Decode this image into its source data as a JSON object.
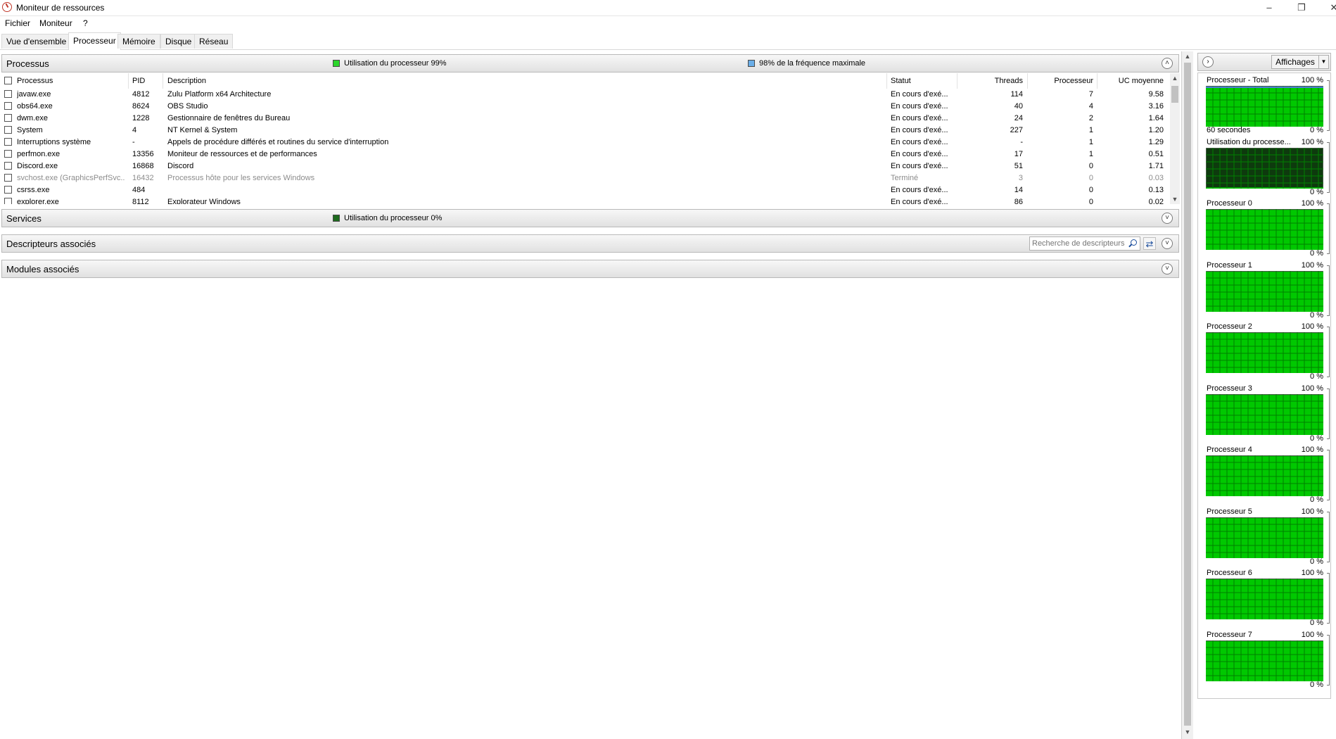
{
  "window": {
    "title": "Moniteur de ressources"
  },
  "menu": [
    "Fichier",
    "Moniteur",
    "?"
  ],
  "tabs": [
    {
      "label": "Vue d'ensemble",
      "active": false
    },
    {
      "label": "Processeur",
      "active": true
    },
    {
      "label": "Mémoire",
      "active": false
    },
    {
      "label": "Disque",
      "active": false
    },
    {
      "label": "Réseau",
      "active": false
    }
  ],
  "colors": {
    "cpu_usage": "#2bd62b",
    "max_freq": "#6aaee8",
    "service_usage": "#1e6b1e",
    "graph_bg": "#0e3a0e",
    "graph_fill": "#00c800",
    "graph_grid": "#008000",
    "freq_line": "#4a7fd4"
  },
  "processes": {
    "title": "Processus",
    "cpu_usage_label": "Utilisation du processeur 99%",
    "max_freq_label": "98% de la fréquence maximale",
    "headers": {
      "name": "Processus",
      "pid": "PID",
      "description": "Description",
      "status": "Statut",
      "threads": "Threads",
      "cpu": "Processeur",
      "avg": "UC moyenne"
    },
    "rows": [
      {
        "name": "javaw.exe",
        "pid": "4812",
        "description": "Zulu Platform x64 Architecture",
        "status": "En cours d'exé...",
        "threads": "114",
        "cpu": "7",
        "avg": "9.58",
        "terminated": false
      },
      {
        "name": "obs64.exe",
        "pid": "8624",
        "description": "OBS Studio",
        "status": "En cours d'exé...",
        "threads": "40",
        "cpu": "4",
        "avg": "3.16",
        "terminated": false
      },
      {
        "name": "dwm.exe",
        "pid": "1228",
        "description": "Gestionnaire de fenêtres du Bureau",
        "status": "En cours d'exé...",
        "threads": "24",
        "cpu": "2",
        "avg": "1.64",
        "terminated": false
      },
      {
        "name": "System",
        "pid": "4",
        "description": "NT Kernel & System",
        "status": "En cours d'exé...",
        "threads": "227",
        "cpu": "1",
        "avg": "1.20",
        "terminated": false
      },
      {
        "name": "Interruptions système",
        "pid": "-",
        "description": "Appels de procédure différés et routines du service d'interruption",
        "status": "En cours d'exé...",
        "threads": "-",
        "cpu": "1",
        "avg": "1.29",
        "terminated": false
      },
      {
        "name": "perfmon.exe",
        "pid": "13356",
        "description": "Moniteur de ressources et de performances",
        "status": "En cours d'exé...",
        "threads": "17",
        "cpu": "1",
        "avg": "0.51",
        "terminated": false
      },
      {
        "name": "Discord.exe",
        "pid": "16868",
        "description": "Discord",
        "status": "En cours d'exé...",
        "threads": "51",
        "cpu": "0",
        "avg": "1.71",
        "terminated": false
      },
      {
        "name": "svchost.exe (GraphicsPerfSvc...",
        "pid": "16432",
        "description": "Processus hôte pour les services Windows",
        "status": "Terminé",
        "threads": "3",
        "cpu": "0",
        "avg": "0.03",
        "terminated": true
      },
      {
        "name": "csrss.exe",
        "pid": "484",
        "description": "",
        "status": "En cours d'exé...",
        "threads": "14",
        "cpu": "0",
        "avg": "0.13",
        "terminated": false
      },
      {
        "name": "explorer.exe",
        "pid": "8112",
        "description": "Explorateur Windows",
        "status": "En cours d'exé...",
        "threads": "86",
        "cpu": "0",
        "avg": "0.02",
        "terminated": false
      }
    ]
  },
  "services": {
    "title": "Services",
    "cpu_usage_label": "Utilisation du processeur 0%"
  },
  "descriptors": {
    "title": "Descripteurs associés",
    "search_placeholder": "Recherche de descripteurs"
  },
  "modules": {
    "title": "Modules associés"
  },
  "side": {
    "views_label": "Affichages",
    "graphs": [
      {
        "title": "Processeur - Total",
        "max": "100 %",
        "min": "0 %",
        "sub": "60 secondes",
        "level": 0.98,
        "freq_line": true
      },
      {
        "title": "Utilisation du processe...",
        "max": "100 %",
        "min": "0 %",
        "sub": "",
        "level": 0.03,
        "freq_line": false
      },
      {
        "title": "Processeur 0",
        "max": "100 %",
        "min": "0 %",
        "sub": "",
        "level": 0.98,
        "freq_line": false
      },
      {
        "title": "Processeur 1",
        "max": "100 %",
        "min": "0 %",
        "sub": "",
        "level": 0.98,
        "freq_line": false
      },
      {
        "title": "Processeur 2",
        "max": "100 %",
        "min": "0 %",
        "sub": "",
        "level": 0.98,
        "freq_line": false
      },
      {
        "title": "Processeur 3",
        "max": "100 %",
        "min": "0 %",
        "sub": "",
        "level": 0.98,
        "freq_line": false
      },
      {
        "title": "Processeur 4",
        "max": "100 %",
        "min": "0 %",
        "sub": "",
        "level": 0.98,
        "freq_line": false
      },
      {
        "title": "Processeur 5",
        "max": "100 %",
        "min": "0 %",
        "sub": "",
        "level": 0.98,
        "freq_line": false
      },
      {
        "title": "Processeur 6",
        "max": "100 %",
        "min": "0 %",
        "sub": "",
        "level": 0.98,
        "freq_line": false
      },
      {
        "title": "Processeur 7",
        "max": "100 %",
        "min": "0 %",
        "sub": "",
        "level": 0.98,
        "freq_line": false
      }
    ]
  }
}
